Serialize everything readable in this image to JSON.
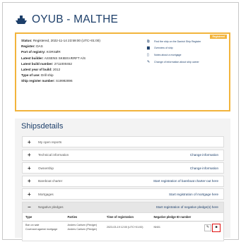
{
  "header": {
    "title": "OYUB - MALTHE",
    "icon": "ship-icon"
  },
  "info_box": {
    "badge": "Registered",
    "facts": [
      {
        "label": "Status:",
        "value": "Registered, 2022-11-14 23:59:00 (UTC+01:00)"
      },
      {
        "label": "Register:",
        "value": "DAS"
      },
      {
        "label": "Port of registry:",
        "value": "KORSØR"
      },
      {
        "label": "Latest builder:",
        "value": "ASSENS SKIBSVÆRFT A/S"
      },
      {
        "label": "Latest build number:",
        "value": "2711000452"
      },
      {
        "label": "Latest year of build:",
        "value": "2012"
      },
      {
        "label": "Type of use:",
        "value": "Drill ship"
      },
      {
        "label": "Ship register number:",
        "value": "S19992896"
      }
    ],
    "actions": [
      {
        "icon": "external-link-icon",
        "label": "Find the ship on the Danish Ship Register"
      },
      {
        "icon": "document-icon",
        "label": "Overview of ship"
      },
      {
        "icon": "file-icon",
        "label": "Notes about a mortgage"
      },
      {
        "icon": "pencil-icon",
        "label": "Change of information about ship owner"
      }
    ]
  },
  "shipdetails": {
    "title": "Shipsdetails",
    "rows": [
      {
        "toggle": "+",
        "label": "My open reports",
        "link": ""
      },
      {
        "toggle": "+",
        "label": "Technical information",
        "link": "Change information"
      },
      {
        "toggle": "+",
        "label": "Ownership",
        "link": "Change information"
      },
      {
        "toggle": "+",
        "label": "Bareboat charter",
        "link": "Start registration of bareboat charter-out here"
      },
      {
        "toggle": "+",
        "label": "Mortgages",
        "link": "Start registration of mortgage here"
      },
      {
        "toggle": "−",
        "label": "Negative pledges",
        "link": "Start registration of negative pledge(s) here"
      }
    ],
    "pledges": {
      "headers": [
        "Type",
        "Parties",
        "Time of registration",
        "Negative pledge ID number"
      ],
      "row": {
        "type_1": "Ban on sale",
        "type_2": "Covenant against mortgage",
        "party_1": "Anders Carlsen (Pledger)",
        "party_2": "Anders Carlsen (Pledger)",
        "time": "2023-03-19 12:00 (UTC+01:00)",
        "id": "NN01"
      }
    }
  },
  "colors": {
    "accent": "#f2b43c",
    "brand": "#1d3f6a",
    "danger": "#e01010"
  }
}
